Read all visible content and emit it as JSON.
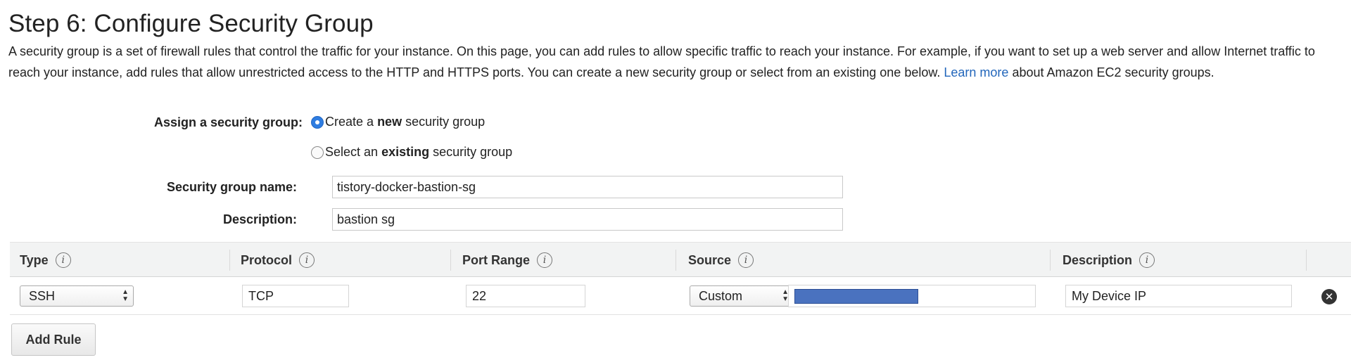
{
  "page": {
    "title": "Step 6: Configure Security Group",
    "intro": "A security group is a set of firewall rules that control the traffic for your instance. On this page, you can add rules to allow specific traffic to reach your instance. For example, if you want to set up a web server and allow Internet traffic to reach your instance, add rules that allow unrestricted access to the HTTP and HTTPS ports. You can create a new security group or select from an existing one below.",
    "learn_more": "Learn more",
    "intro_tail": "about Amazon EC2 security groups."
  },
  "assign": {
    "label": "Assign a security group:",
    "options": [
      {
        "prefix": "Create a ",
        "bold": "new",
        "suffix": " security group",
        "checked": true
      },
      {
        "prefix": "Select an ",
        "bold": "existing",
        "suffix": " security group",
        "checked": false
      }
    ]
  },
  "form": {
    "name_label": "Security group name:",
    "name_value": "tistory-docker-bastion-sg",
    "desc_label": "Description:",
    "desc_value": "bastion sg"
  },
  "table": {
    "headers": [
      "Type",
      "Protocol",
      "Port Range",
      "Source",
      "Description"
    ],
    "info_glyph": "i",
    "rows": [
      {
        "type": "SSH",
        "protocol": "TCP",
        "port_range": "22",
        "source_mode": "Custom",
        "description": "My Device IP"
      }
    ]
  },
  "actions": {
    "add_rule": "Add Rule"
  },
  "colors": {
    "link": "#2266bb",
    "radio_selected": "#2f7de1",
    "redaction": "#4a72bf"
  }
}
